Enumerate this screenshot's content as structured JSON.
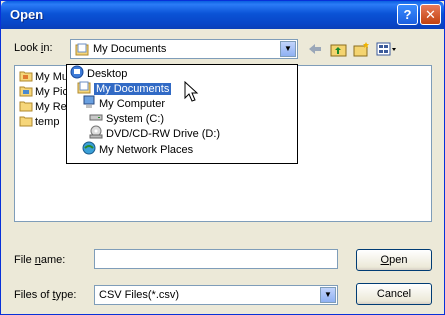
{
  "window": {
    "title": "Open",
    "help_glyph": "?",
    "close_glyph": "✕"
  },
  "lookin": {
    "label_pre": "Look ",
    "label_u": "i",
    "label_post": "n:",
    "value": "My Documents"
  },
  "files": [
    {
      "name": "My Mu"
    },
    {
      "name": "My Pic"
    },
    {
      "name": "My Re"
    },
    {
      "name": "temp"
    }
  ],
  "dropdown": [
    {
      "label": "Desktop",
      "icon": "desktop-icon"
    },
    {
      "label": "My Documents",
      "icon": "my-documents-icon",
      "selected": true
    },
    {
      "label": "My Computer",
      "icon": "my-computer-icon"
    },
    {
      "label": "System (C:)",
      "icon": "drive-icon"
    },
    {
      "label": "DVD/CD-RW Drive (D:)",
      "icon": "dvd-drive-icon"
    },
    {
      "label": "My Network Places",
      "icon": "network-places-icon"
    }
  ],
  "filename": {
    "label_pre": "File ",
    "label_u": "n",
    "label_post": "ame:",
    "value": ""
  },
  "filetype": {
    "label_pre": "Files of ",
    "label_u": "t",
    "label_post": "ype:",
    "value": "CSV Files(*.csv)"
  },
  "buttons": {
    "open_u": "O",
    "open_rest": "pen",
    "cancel": "Cancel"
  }
}
